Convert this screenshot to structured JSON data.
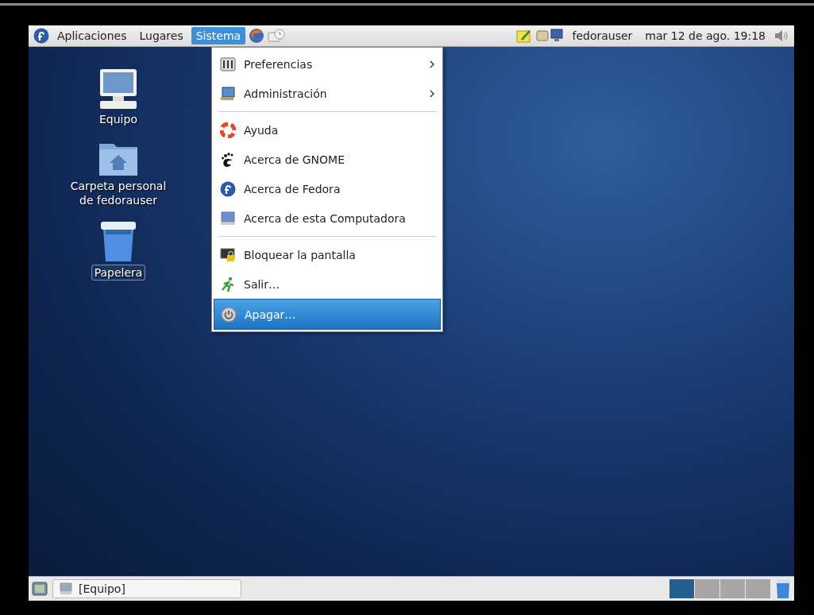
{
  "top_panel": {
    "menus": [
      {
        "label": "Aplicaciones",
        "selected": false
      },
      {
        "label": "Lugares",
        "selected": false
      },
      {
        "label": "Sistema",
        "selected": true
      }
    ],
    "user": "fedorauser",
    "clock": "mar 12 de ago. 19:18"
  },
  "system_menu": {
    "items": [
      {
        "kind": "item",
        "label": "Preferencias",
        "submenu": true,
        "selected": false
      },
      {
        "kind": "item",
        "label": "Administración",
        "submenu": true,
        "selected": false
      },
      {
        "kind": "separator"
      },
      {
        "kind": "item",
        "label": "Ayuda",
        "submenu": false,
        "selected": false
      },
      {
        "kind": "item",
        "label": "Acerca de GNOME",
        "submenu": false,
        "selected": false
      },
      {
        "kind": "item",
        "label": "Acerca de Fedora",
        "submenu": false,
        "selected": false
      },
      {
        "kind": "item",
        "label": "Acerca de esta Computadora",
        "submenu": false,
        "selected": false
      },
      {
        "kind": "separator"
      },
      {
        "kind": "item",
        "label": "Bloquear la pantalla",
        "submenu": false,
        "selected": false
      },
      {
        "kind": "item",
        "label": "Salir…",
        "submenu": false,
        "selected": false
      },
      {
        "kind": "item",
        "label": "Apagar…",
        "submenu": false,
        "selected": true
      }
    ]
  },
  "desktop_icons": [
    {
      "label": "Equipo",
      "selected": false
    },
    {
      "label": "Carpeta personal de fedorauser",
      "selected": false
    },
    {
      "label": "Papelera",
      "selected": true
    }
  ],
  "bottom_panel": {
    "windows": [
      {
        "label": "[Equipo]"
      }
    ],
    "workspaces": [
      {
        "selected": true
      },
      {
        "selected": false
      },
      {
        "selected": false
      },
      {
        "selected": false
      }
    ]
  }
}
